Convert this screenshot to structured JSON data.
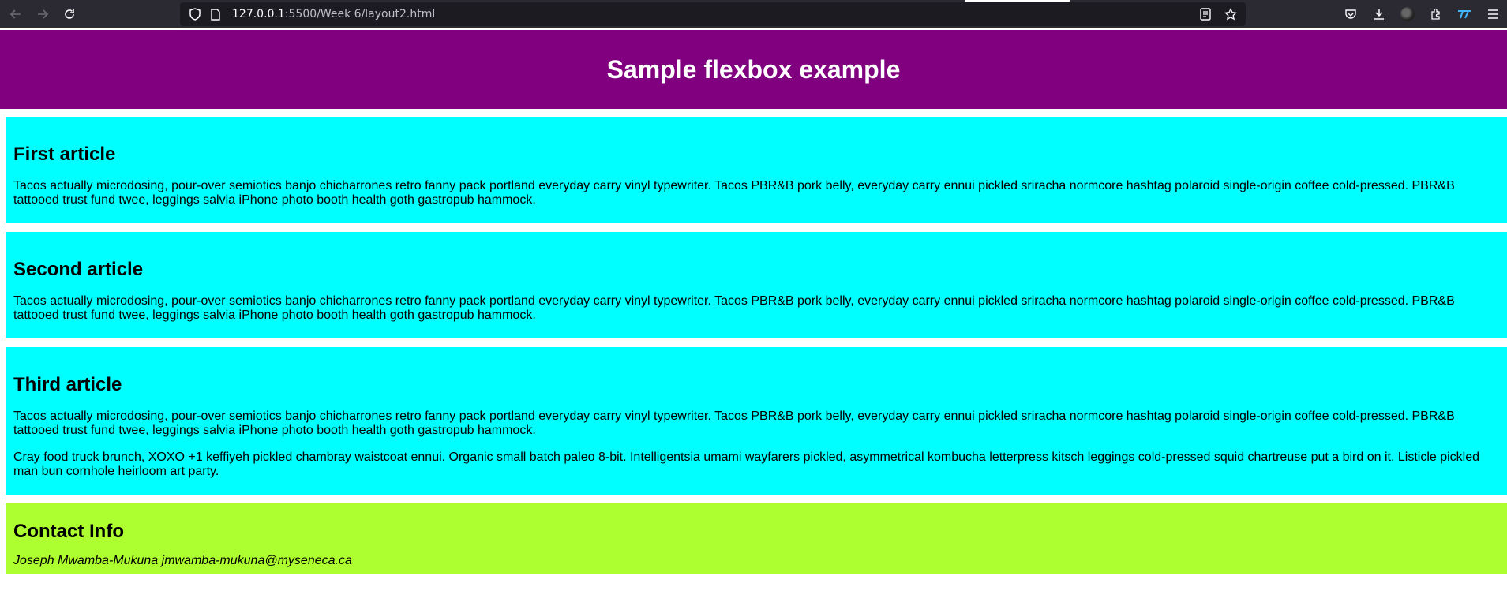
{
  "browser": {
    "url_host": "127.0.0.1",
    "url_rest": ":5500/Week 6/layout2.html"
  },
  "header": {
    "title": "Sample flexbox example"
  },
  "articles": [
    {
      "title": "First article",
      "paragraphs": [
        "Tacos actually microdosing, pour-over semiotics banjo chicharrones retro fanny pack portland everyday carry vinyl typewriter. Tacos PBR&B pork belly, everyday carry ennui pickled sriracha normcore hashtag polaroid single-origin coffee cold-pressed. PBR&B tattooed trust fund twee, leggings salvia iPhone photo booth health goth gastropub hammock."
      ]
    },
    {
      "title": "Second article",
      "paragraphs": [
        "Tacos actually microdosing, pour-over semiotics banjo chicharrones retro fanny pack portland everyday carry vinyl typewriter. Tacos PBR&B pork belly, everyday carry ennui pickled sriracha normcore hashtag polaroid single-origin coffee cold-pressed. PBR&B tattooed trust fund twee, leggings salvia iPhone photo booth health goth gastropub hammock."
      ]
    },
    {
      "title": "Third article",
      "paragraphs": [
        "Tacos actually microdosing, pour-over semiotics banjo chicharrones retro fanny pack portland everyday carry vinyl typewriter. Tacos PBR&B pork belly, everyday carry ennui pickled sriracha normcore hashtag polaroid single-origin coffee cold-pressed. PBR&B tattooed trust fund twee, leggings salvia iPhone photo booth health goth gastropub hammock.",
        "Cray food truck brunch, XOXO +1 keffiyeh pickled chambray waistcoat ennui. Organic small batch paleo 8-bit. Intelligentsia umami wayfarers pickled, asymmetrical kombucha letterpress kitsch leggings cold-pressed squid chartreuse put a bird on it. Listicle pickled man bun cornhole heirloom art party."
      ]
    }
  ],
  "contact": {
    "title": "Contact Info",
    "text": "Joseph Mwamba-Mukuna jmwamba-mukuna@myseneca.ca"
  },
  "colors": {
    "header_bg": "#800080",
    "article_bg": "#00ffff",
    "contact_bg": "#adff2f",
    "chrome_bg": "#2b2a33"
  },
  "icons": {
    "toolbar_left": [
      "back-arrow-icon",
      "forward-arrow-icon",
      "reload-icon"
    ],
    "urlbar": [
      "shield-icon",
      "page-icon",
      "reader-view-icon",
      "bookmark-star-icon"
    ],
    "toolbar_right": [
      "pocket-icon",
      "download-icon",
      "account-avatar",
      "extensions-icon",
      "extension-icon",
      "menu-icon"
    ]
  }
}
